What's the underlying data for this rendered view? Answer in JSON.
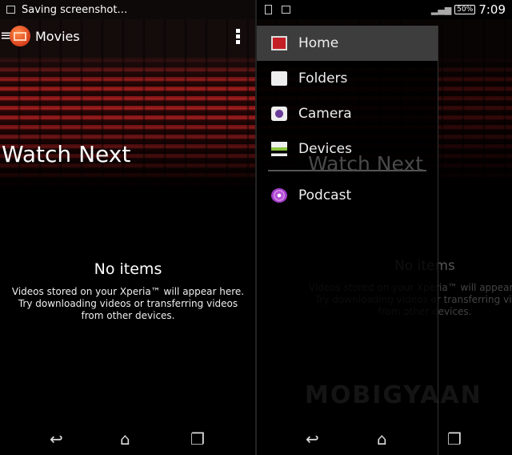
{
  "left": {
    "status_text": "Saving screenshot…",
    "app_title": "Movies",
    "section_title": "Watch Next",
    "empty_title": "No items",
    "empty_lines": [
      "Videos stored on your Xperia™ will appear here.",
      "Try downloading videos or transferring videos",
      "from other devices."
    ]
  },
  "right": {
    "status": {
      "battery": "50%",
      "time": "7:09"
    },
    "drawer": [
      {
        "label": "Home",
        "icon": "home-tiles-icon",
        "selected": true
      },
      {
        "label": "Folders",
        "icon": "folder-icon"
      },
      {
        "label": "Camera",
        "icon": "camera-icon"
      },
      {
        "label": "Devices",
        "icon": "devices-network-icon"
      },
      {
        "label": "Podcast",
        "icon": "podcast-icon"
      }
    ],
    "section_title": "Watch Next",
    "empty_title": "No items",
    "empty_lines": [
      "Videos stored on your Xperia™ will appear here.",
      "Try downloading videos or transferring videos",
      "from other devices."
    ]
  },
  "watermark": "MOBIGYAAN",
  "colors": {
    "accent": "#d8401c",
    "drawer_selected": "#3d3d3d"
  }
}
